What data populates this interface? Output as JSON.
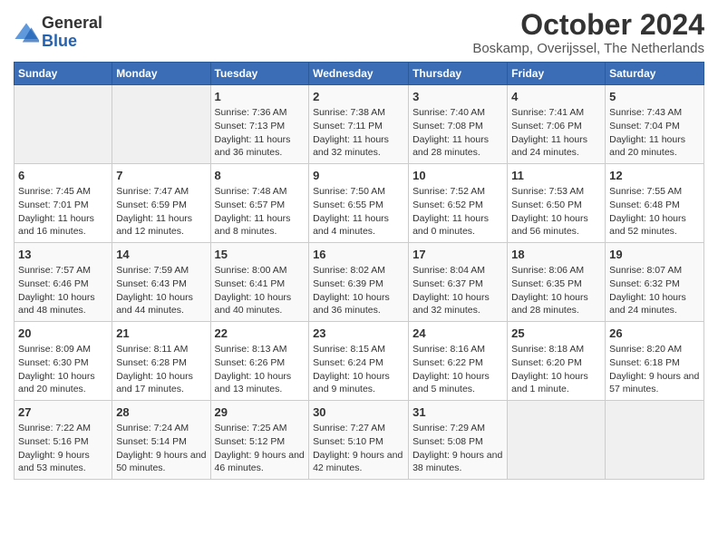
{
  "logo": {
    "general": "General",
    "blue": "Blue"
  },
  "title": "October 2024",
  "subtitle": "Boskamp, Overijssel, The Netherlands",
  "days_of_week": [
    "Sunday",
    "Monday",
    "Tuesday",
    "Wednesday",
    "Thursday",
    "Friday",
    "Saturday"
  ],
  "weeks": [
    [
      {
        "day": "",
        "info": ""
      },
      {
        "day": "",
        "info": ""
      },
      {
        "day": "1",
        "info": "Sunrise: 7:36 AM\nSunset: 7:13 PM\nDaylight: 11 hours and 36 minutes."
      },
      {
        "day": "2",
        "info": "Sunrise: 7:38 AM\nSunset: 7:11 PM\nDaylight: 11 hours and 32 minutes."
      },
      {
        "day": "3",
        "info": "Sunrise: 7:40 AM\nSunset: 7:08 PM\nDaylight: 11 hours and 28 minutes."
      },
      {
        "day": "4",
        "info": "Sunrise: 7:41 AM\nSunset: 7:06 PM\nDaylight: 11 hours and 24 minutes."
      },
      {
        "day": "5",
        "info": "Sunrise: 7:43 AM\nSunset: 7:04 PM\nDaylight: 11 hours and 20 minutes."
      }
    ],
    [
      {
        "day": "6",
        "info": "Sunrise: 7:45 AM\nSunset: 7:01 PM\nDaylight: 11 hours and 16 minutes."
      },
      {
        "day": "7",
        "info": "Sunrise: 7:47 AM\nSunset: 6:59 PM\nDaylight: 11 hours and 12 minutes."
      },
      {
        "day": "8",
        "info": "Sunrise: 7:48 AM\nSunset: 6:57 PM\nDaylight: 11 hours and 8 minutes."
      },
      {
        "day": "9",
        "info": "Sunrise: 7:50 AM\nSunset: 6:55 PM\nDaylight: 11 hours and 4 minutes."
      },
      {
        "day": "10",
        "info": "Sunrise: 7:52 AM\nSunset: 6:52 PM\nDaylight: 11 hours and 0 minutes."
      },
      {
        "day": "11",
        "info": "Sunrise: 7:53 AM\nSunset: 6:50 PM\nDaylight: 10 hours and 56 minutes."
      },
      {
        "day": "12",
        "info": "Sunrise: 7:55 AM\nSunset: 6:48 PM\nDaylight: 10 hours and 52 minutes."
      }
    ],
    [
      {
        "day": "13",
        "info": "Sunrise: 7:57 AM\nSunset: 6:46 PM\nDaylight: 10 hours and 48 minutes."
      },
      {
        "day": "14",
        "info": "Sunrise: 7:59 AM\nSunset: 6:43 PM\nDaylight: 10 hours and 44 minutes."
      },
      {
        "day": "15",
        "info": "Sunrise: 8:00 AM\nSunset: 6:41 PM\nDaylight: 10 hours and 40 minutes."
      },
      {
        "day": "16",
        "info": "Sunrise: 8:02 AM\nSunset: 6:39 PM\nDaylight: 10 hours and 36 minutes."
      },
      {
        "day": "17",
        "info": "Sunrise: 8:04 AM\nSunset: 6:37 PM\nDaylight: 10 hours and 32 minutes."
      },
      {
        "day": "18",
        "info": "Sunrise: 8:06 AM\nSunset: 6:35 PM\nDaylight: 10 hours and 28 minutes."
      },
      {
        "day": "19",
        "info": "Sunrise: 8:07 AM\nSunset: 6:32 PM\nDaylight: 10 hours and 24 minutes."
      }
    ],
    [
      {
        "day": "20",
        "info": "Sunrise: 8:09 AM\nSunset: 6:30 PM\nDaylight: 10 hours and 20 minutes."
      },
      {
        "day": "21",
        "info": "Sunrise: 8:11 AM\nSunset: 6:28 PM\nDaylight: 10 hours and 17 minutes."
      },
      {
        "day": "22",
        "info": "Sunrise: 8:13 AM\nSunset: 6:26 PM\nDaylight: 10 hours and 13 minutes."
      },
      {
        "day": "23",
        "info": "Sunrise: 8:15 AM\nSunset: 6:24 PM\nDaylight: 10 hours and 9 minutes."
      },
      {
        "day": "24",
        "info": "Sunrise: 8:16 AM\nSunset: 6:22 PM\nDaylight: 10 hours and 5 minutes."
      },
      {
        "day": "25",
        "info": "Sunrise: 8:18 AM\nSunset: 6:20 PM\nDaylight: 10 hours and 1 minute."
      },
      {
        "day": "26",
        "info": "Sunrise: 8:20 AM\nSunset: 6:18 PM\nDaylight: 9 hours and 57 minutes."
      }
    ],
    [
      {
        "day": "27",
        "info": "Sunrise: 7:22 AM\nSunset: 5:16 PM\nDaylight: 9 hours and 53 minutes."
      },
      {
        "day": "28",
        "info": "Sunrise: 7:24 AM\nSunset: 5:14 PM\nDaylight: 9 hours and 50 minutes."
      },
      {
        "day": "29",
        "info": "Sunrise: 7:25 AM\nSunset: 5:12 PM\nDaylight: 9 hours and 46 minutes."
      },
      {
        "day": "30",
        "info": "Sunrise: 7:27 AM\nSunset: 5:10 PM\nDaylight: 9 hours and 42 minutes."
      },
      {
        "day": "31",
        "info": "Sunrise: 7:29 AM\nSunset: 5:08 PM\nDaylight: 9 hours and 38 minutes."
      },
      {
        "day": "",
        "info": ""
      },
      {
        "day": "",
        "info": ""
      }
    ]
  ]
}
